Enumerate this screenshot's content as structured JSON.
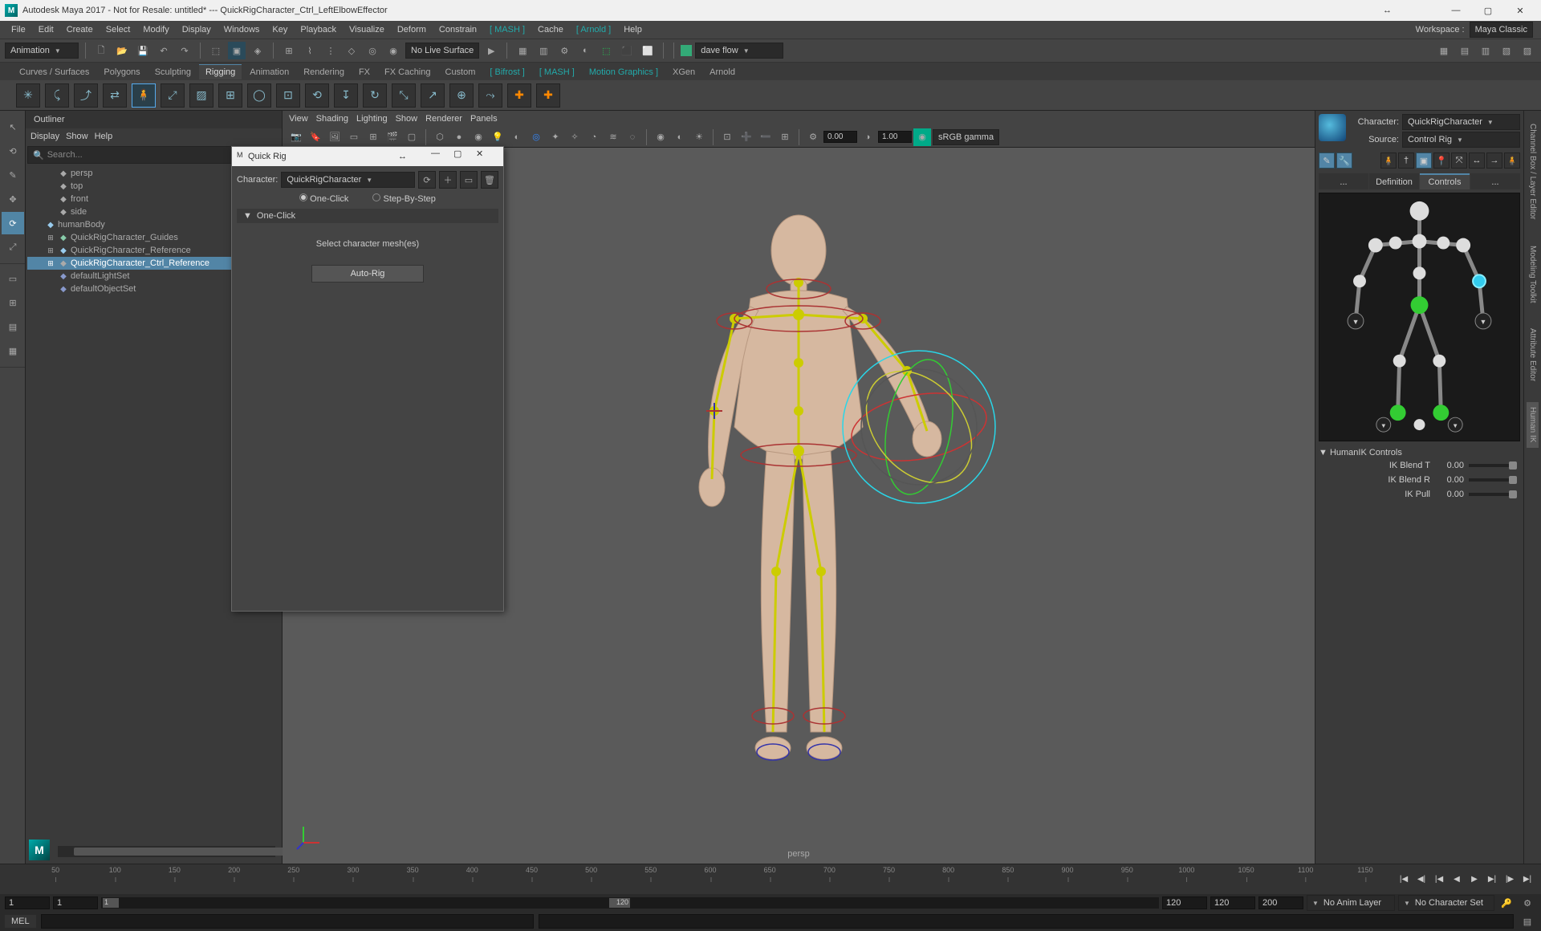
{
  "title": "Autodesk Maya 2017 - Not for Resale: untitled*  ---  QuickRigCharacter_Ctrl_LeftElbowEffector",
  "menubar": [
    "File",
    "Edit",
    "Create",
    "Select",
    "Modify",
    "Display",
    "Windows",
    "Key",
    "Playback",
    "Visualize",
    "Deform",
    "Constrain"
  ],
  "menubar_bracket1": "[ MASH ]",
  "menubar_mid": [
    "Cache"
  ],
  "menubar_bracket2": "[ Arnold ]",
  "menubar_end": [
    "Help"
  ],
  "workspace_label": "Workspace :",
  "workspace_value": "Maya Classic",
  "mode_dropdown": "Animation",
  "live_surface": "No Live Surface",
  "user": "dave flow",
  "shelf_tabs": [
    "Curves / Surfaces",
    "Polygons",
    "Sculpting",
    "Rigging",
    "Animation",
    "Rendering",
    "FX",
    "FX Caching",
    "Custom",
    "[ Bifrost ]",
    "[ MASH ]",
    "Motion Graphics ]",
    "XGen",
    "Arnold"
  ],
  "active_shelf": "Rigging",
  "outliner": {
    "title": "Outliner",
    "menu": [
      "Display",
      "Show",
      "Help"
    ],
    "search_placeholder": "Search...",
    "items": [
      {
        "icon": "camera",
        "label": "persp",
        "indent": 1
      },
      {
        "icon": "camera",
        "label": "top",
        "indent": 1
      },
      {
        "icon": "camera",
        "label": "front",
        "indent": 1
      },
      {
        "icon": "camera",
        "label": "side",
        "indent": 1
      },
      {
        "icon": "mesh",
        "label": "humanBody",
        "indent": 0,
        "color": "#9ce"
      },
      {
        "icon": "guides",
        "label": "QuickRigCharacter_Guides",
        "indent": 1,
        "exp": "+",
        "color": "#8ca"
      },
      {
        "icon": "ref",
        "label": "QuickRigCharacter_Reference",
        "indent": 1,
        "exp": "+",
        "color": "#9ce"
      },
      {
        "icon": "ref",
        "label": "QuickRigCharacter_Ctrl_Reference",
        "indent": 1,
        "exp": "+",
        "sel": true
      },
      {
        "icon": "set",
        "label": "defaultLightSet",
        "indent": 1,
        "color": "#89c"
      },
      {
        "icon": "set",
        "label": "defaultObjectSet",
        "indent": 1,
        "color": "#89c"
      }
    ]
  },
  "viewport_menu": [
    "View",
    "Shading",
    "Lighting",
    "Show",
    "Renderer",
    "Panels"
  ],
  "vtoolbar_num1": "0.00",
  "vtoolbar_num2": "1.00",
  "color_mgmt": "sRGB gamma",
  "persp": "persp",
  "quickrig": {
    "title": "Quick Rig",
    "char_label": "Character:",
    "char_value": "QuickRigCharacter",
    "tab1": "One-Click",
    "tab2": "Step-By-Step",
    "section": "One-Click",
    "hint": "Select character mesh(es)",
    "button": "Auto-Rig"
  },
  "right": {
    "char_label": "Character:",
    "char_value": "QuickRigCharacter",
    "src_label": "Source:",
    "src_value": "Control Rig",
    "tabs": [
      "...",
      "Definition",
      "Controls",
      "..."
    ],
    "active_tab": "Controls",
    "ctrl_section": "HumanIK Controls",
    "sliders": [
      {
        "label": "IK Blend T",
        "val": "0.00"
      },
      {
        "label": "IK Blend R",
        "val": "0.00"
      },
      {
        "label": "IK Pull",
        "val": "0.00"
      }
    ]
  },
  "right_strip": [
    "Channel Box / Layer Editor",
    "Modeling Toolkit",
    "Attribute Editor",
    "Human IK"
  ],
  "timeline_ticks": [
    50,
    100,
    150,
    200,
    250,
    300,
    350,
    400,
    450,
    500,
    550,
    600,
    650,
    700,
    750,
    800,
    850,
    900,
    950,
    1000,
    1050,
    1100,
    1150
  ],
  "range": {
    "a": "1",
    "b": "1",
    "c": "1",
    "d": "120",
    "e": "120",
    "f": "120",
    "g": "200"
  },
  "anim_layer": "No Anim Layer",
  "char_set": "No Character Set",
  "cmd": "MEL"
}
